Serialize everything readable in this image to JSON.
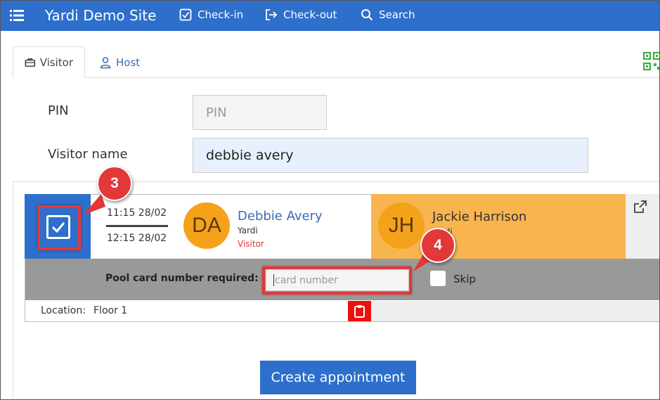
{
  "topbar": {
    "brand": "Yardi Demo Site",
    "nav": {
      "checkin": "Check-in",
      "checkout": "Check-out",
      "search": "Search"
    }
  },
  "tabs": {
    "visitor": "Visitor",
    "host": "Host"
  },
  "form": {
    "pin_label": "PIN",
    "pin_placeholder": "PIN",
    "visitor_name_label": "Visitor name",
    "visitor_name_value": "debbie avery"
  },
  "appointment": {
    "time_start": "11:15 28/02",
    "time_end": "12:15 28/02",
    "visitor": {
      "initials": "DA",
      "name": "Debbie Avery",
      "company": "Yardi",
      "role": "Visitor"
    },
    "host": {
      "initials": "JH",
      "name": "Jackie Harrison",
      "company": "Yardi"
    },
    "pool_card_label": "Pool card number required:",
    "card_number_placeholder": "card number",
    "skip_label": "Skip",
    "location_label": "Location:",
    "location_value": "Floor 1"
  },
  "actions": {
    "create_appointment": "Create appointment"
  },
  "annotations": {
    "step_3": "3",
    "step_4": "4"
  },
  "colors": {
    "primary": "#2d6fcb",
    "avatar": "#f5a21b",
    "host_bg": "#f8b44f",
    "annotation": "#e2383a",
    "clipboard_button": "#e8130f",
    "qr_icon": "#3cb043"
  }
}
